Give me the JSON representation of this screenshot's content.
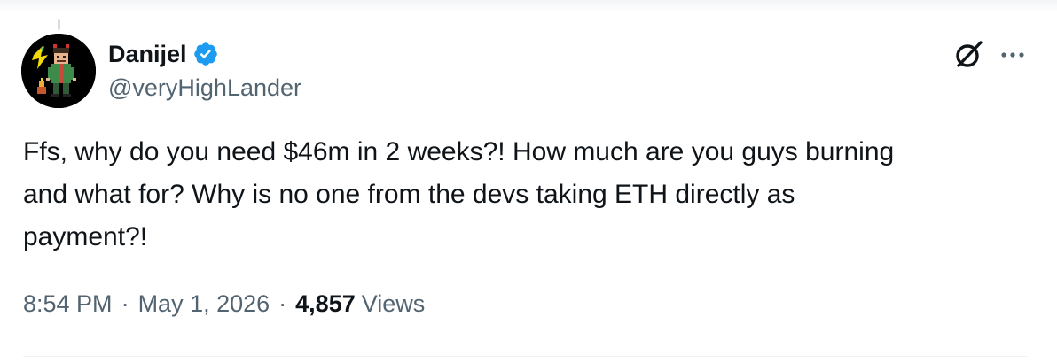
{
  "tweet": {
    "author": {
      "display_name": "Danijel",
      "handle": "@veryHighLander",
      "verified": true
    },
    "text": "Ffs, why do you need $46m in 2 weeks?! How much are you guys burning\nand what for? Why is no one from the devs taking ETH directly as\npayment?!",
    "meta": {
      "time": "8:54 PM",
      "separator": "·",
      "date": "May 1, 2026",
      "views_count": "4,857",
      "views_label": "Views"
    }
  },
  "icons": {
    "avatar": "pixel-art-avatar",
    "verified": "verified-badge-icon",
    "grok": "grok-icon",
    "more": "more-options-icon"
  },
  "colors": {
    "text_primary": "#0f1419",
    "text_secondary": "#536471",
    "verified_blue": "#1d9bf0",
    "background": "#ffffff"
  }
}
